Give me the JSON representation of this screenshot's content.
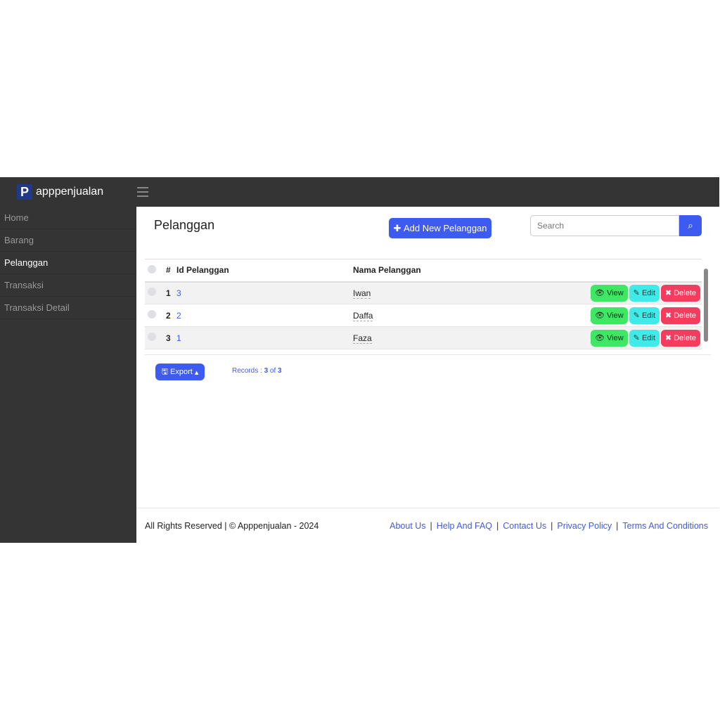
{
  "brand": {
    "logo_letter": "P",
    "name": "apppenjualan"
  },
  "sidebar": {
    "items": [
      {
        "label": "Home"
      },
      {
        "label": "Barang"
      },
      {
        "label": "Pelanggan",
        "active": true
      },
      {
        "label": "Transaksi"
      },
      {
        "label": "Transaksi Detail"
      }
    ]
  },
  "page": {
    "title": "Pelanggan",
    "add_label": "Add New Pelanggan",
    "search_placeholder": "Search"
  },
  "table": {
    "headers": [
      "#",
      "Id Pelanggan",
      "Nama Pelanggan"
    ],
    "rows": [
      {
        "no": "1",
        "id": "3",
        "nama": "Iwan"
      },
      {
        "no": "2",
        "id": "2",
        "nama": "Daffa"
      },
      {
        "no": "3",
        "id": "1",
        "nama": "Faza"
      }
    ],
    "actions": {
      "view": "View",
      "edit": "Edit",
      "delete": "Delete"
    }
  },
  "export_label": "Export",
  "records": {
    "prefix": "Records : ",
    "shown": "3",
    "of": " of ",
    "total": "3"
  },
  "footer": {
    "copyright": "All Rights Reserved | © Apppenjualan - 2024",
    "links": [
      "About Us",
      "Help And FAQ",
      "Contact Us",
      "Privacy Policy",
      "Terms And Conditions"
    ]
  }
}
